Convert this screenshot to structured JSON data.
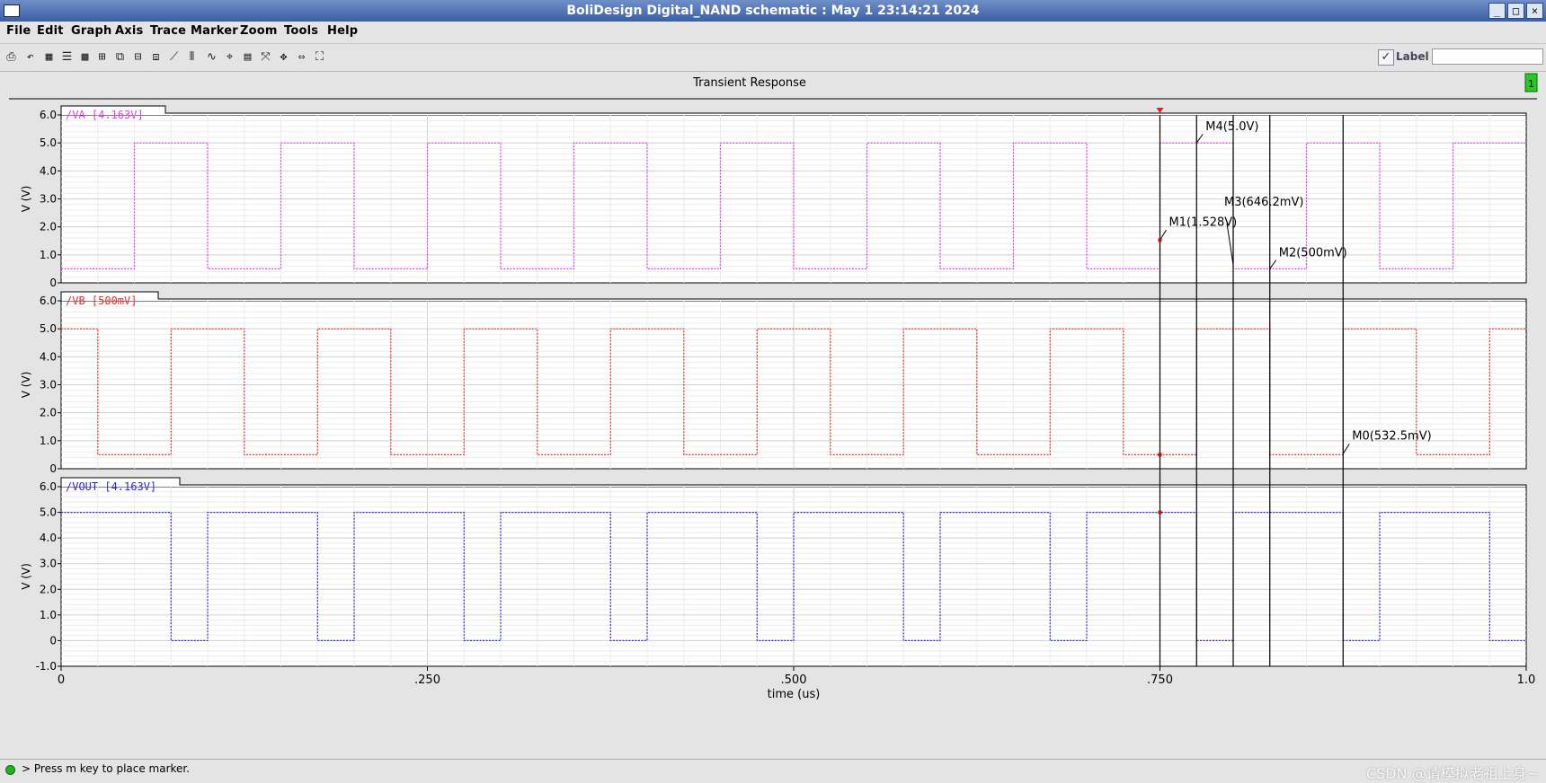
{
  "window": {
    "title": "BoliDesign Digital_NAND schematic : May  1 23:14:21 2024",
    "controls": [
      "_",
      "□",
      "×"
    ]
  },
  "menu": [
    "File",
    "Edit",
    "Graph",
    "Axis",
    "Trace",
    "Marker",
    "Zoom",
    "Tools",
    "Help"
  ],
  "toolbar": {
    "icons": [
      "print-icon",
      "undo-icon",
      "grid-icon",
      "strips-icon",
      "bg-icon",
      "add-subwindow-icon",
      "zoom-box-icon",
      "layout-icon",
      "split-icon",
      "axis-icon",
      "bars-icon",
      "trace-icon",
      "cursor-icon",
      "calc-icon",
      "fit-icon",
      "pan-x-icon",
      "pan-y-icon",
      "full-view-icon"
    ],
    "label_check": "✓",
    "label_text": "Label",
    "label_value": ""
  },
  "graph": {
    "title": "Transient Response",
    "subwindow_badge": "1",
    "x_axis_label": "time (us)"
  },
  "status": {
    "message": "> Press m key to place marker.",
    "watermark": "CSDN @请模拟老祖上身~"
  },
  "chart_data": {
    "type": "line",
    "title": "Transient Response",
    "xlabel": "time (us)",
    "xlim": [
      0,
      1.0
    ],
    "x_ticks": [
      0,
      0.25,
      0.5,
      0.75,
      1.0
    ],
    "x_tick_labels": [
      "0",
      ".250",
      ".500",
      ".750",
      "1.0"
    ],
    "grid": true,
    "panels": [
      {
        "trace": "/VA",
        "legend": "/VA  [4.163V]",
        "color": "#e040e0",
        "ylabel": "V (V)",
        "ylim": [
          0,
          6.0
        ],
        "y_ticks": [
          0,
          1.0,
          2.0,
          3.0,
          4.0,
          5.0,
          6.0
        ],
        "y_tick_labels": [
          "0",
          "1.0",
          "2.0",
          "3.0",
          "4.0",
          "5.0",
          "6.0"
        ],
        "x": [
          0,
          0.05,
          0.05,
          0.1,
          0.1,
          0.15,
          0.15,
          0.2,
          0.2,
          0.25,
          0.25,
          0.3,
          0.3,
          0.35,
          0.35,
          0.4,
          0.4,
          0.45,
          0.45,
          0.5,
          0.5,
          0.55,
          0.55,
          0.6,
          0.6,
          0.65,
          0.65,
          0.7,
          0.7,
          0.75,
          0.75,
          0.8,
          0.8,
          0.85,
          0.85,
          0.9,
          0.9,
          0.95,
          0.95,
          1.0
        ],
        "y": [
          0.5,
          0.5,
          5.0,
          5.0,
          0.5,
          0.5,
          5.0,
          5.0,
          0.5,
          0.5,
          5.0,
          5.0,
          0.5,
          0.5,
          5.0,
          5.0,
          0.5,
          0.5,
          5.0,
          5.0,
          0.5,
          0.5,
          5.0,
          5.0,
          0.5,
          0.5,
          5.0,
          5.0,
          0.5,
          0.5,
          5.0,
          5.0,
          0.5,
          0.5,
          5.0,
          5.0,
          0.5,
          0.5,
          5.0,
          5.0
        ]
      },
      {
        "trace": "/VB",
        "legend": "/VB  [500mV]",
        "color": "#e03030",
        "ylabel": "V (V)",
        "ylim": [
          0,
          6.0
        ],
        "y_ticks": [
          0,
          1.0,
          2.0,
          3.0,
          4.0,
          5.0,
          6.0
        ],
        "y_tick_labels": [
          "0",
          "1.0",
          "2.0",
          "3.0",
          "4.0",
          "5.0",
          "6.0"
        ],
        "x": [
          0,
          0.025,
          0.025,
          0.075,
          0.075,
          0.125,
          0.125,
          0.175,
          0.175,
          0.225,
          0.225,
          0.275,
          0.275,
          0.325,
          0.325,
          0.375,
          0.375,
          0.425,
          0.425,
          0.475,
          0.475,
          0.525,
          0.525,
          0.575,
          0.575,
          0.625,
          0.625,
          0.675,
          0.675,
          0.725,
          0.725,
          0.775,
          0.775,
          0.825,
          0.825,
          0.875,
          0.875,
          0.925,
          0.925,
          0.975,
          0.975,
          1.0
        ],
        "y": [
          5.0,
          5.0,
          0.5,
          0.5,
          5.0,
          5.0,
          0.5,
          0.5,
          5.0,
          5.0,
          0.5,
          0.5,
          5.0,
          5.0,
          0.5,
          0.5,
          5.0,
          5.0,
          0.5,
          0.5,
          5.0,
          5.0,
          0.5,
          0.5,
          5.0,
          5.0,
          0.5,
          0.5,
          5.0,
          5.0,
          0.5,
          0.5,
          5.0,
          5.0,
          0.5,
          0.5,
          5.0,
          5.0,
          0.5,
          0.5,
          5.0,
          5.0
        ]
      },
      {
        "trace": "/VOUT",
        "legend": "/VOUT  [4.163V]",
        "color": "#2a2ad8",
        "ylabel": "V (V)",
        "ylim": [
          -1.0,
          6.0
        ],
        "y_ticks": [
          -1.0,
          0,
          1.0,
          2.0,
          3.0,
          4.0,
          5.0,
          6.0
        ],
        "y_tick_labels": [
          "-1.0",
          "0",
          "1.0",
          "2.0",
          "3.0",
          "4.0",
          "5.0",
          "6.0"
        ],
        "x": [
          0,
          0.075,
          0.075,
          0.1,
          0.1,
          0.175,
          0.175,
          0.2,
          0.2,
          0.275,
          0.275,
          0.3,
          0.3,
          0.375,
          0.375,
          0.4,
          0.4,
          0.475,
          0.475,
          0.5,
          0.5,
          0.575,
          0.575,
          0.6,
          0.6,
          0.675,
          0.675,
          0.7,
          0.7,
          0.775,
          0.775,
          0.8,
          0.8,
          0.875,
          0.875,
          0.9,
          0.9,
          0.975,
          0.975,
          1.0
        ],
        "y": [
          5.0,
          5.0,
          0,
          0,
          5.0,
          5.0,
          0,
          0,
          5.0,
          5.0,
          0,
          0,
          5.0,
          5.0,
          0,
          0,
          5.0,
          5.0,
          0,
          0,
          5.0,
          5.0,
          0,
          0,
          5.0,
          5.0,
          0,
          0,
          5.0,
          5.0,
          0,
          0,
          5.0,
          5.0,
          0,
          0,
          5.0,
          5.0,
          0,
          0
        ]
      }
    ],
    "markers": [
      {
        "name": "M1",
        "label": "M1(1.528V)",
        "x": 0.75,
        "panel": 0,
        "y": 1.528
      },
      {
        "name": "M4",
        "label": "M4(5.0V)",
        "x": 0.775,
        "panel": 0,
        "y": 5.0
      },
      {
        "name": "M3",
        "label": "M3(646.2mV)",
        "x": 0.8,
        "panel": 0,
        "y": 0.6462
      },
      {
        "name": "M2",
        "label": "M2(500mV)",
        "x": 0.825,
        "panel": 0,
        "y": 0.5
      },
      {
        "name": "M0",
        "label": "M0(532.5mV)",
        "x": 0.875,
        "panel": 1,
        "y": 0.5325
      }
    ]
  }
}
